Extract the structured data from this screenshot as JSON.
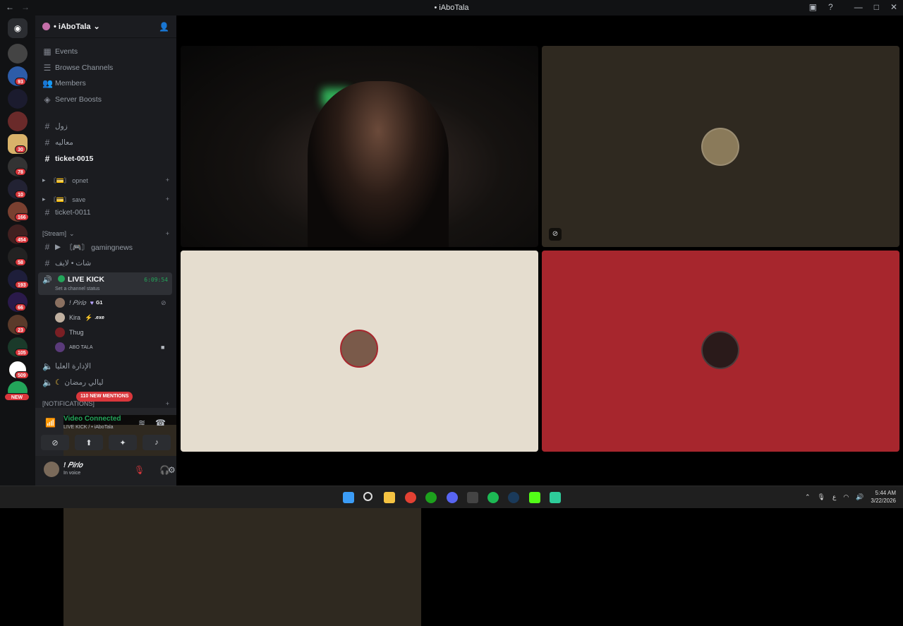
{
  "window": {
    "title": "• iAboTala"
  },
  "server": {
    "name": "• iAboTala"
  },
  "nav": [
    {
      "label": "Events",
      "icon": "calendar-icon"
    },
    {
      "label": "Browse Channels",
      "icon": "browse-icon"
    },
    {
      "label": "Members",
      "icon": "members-icon"
    },
    {
      "label": "Server Boosts",
      "icon": "boost-icon"
    }
  ],
  "channels": {
    "c1": "زول",
    "c2": "معاليه",
    "c3": "ticket-0015",
    "cat1": "〘💳〙 opnet",
    "cat2": "〘💳〙 save",
    "c4": "ticket-0011",
    "cat3": "[Stream]",
    "c5": "〘🎮〙 gamingnews",
    "c6": "شات • لايف",
    "live_name": "LIVE KICK",
    "live_timer": "6:09:54",
    "live_status": "Set a channel status",
    "c7": "الإدارة العليا",
    "c8": "ليالي رمضان",
    "cat4": "[NOTIFICATIONS]"
  },
  "voice_users": [
    {
      "name": "! 𝑃𝑖𝑟𝑙𝑜",
      "tag": "G1"
    },
    {
      "name": "Kira",
      "tag": ".exe"
    },
    {
      "name": "Thug",
      "tag": ""
    },
    {
      "name": "ABO TALA",
      "tag": ""
    }
  ],
  "mentions_pill": "110 NEW MENTIONS",
  "voice_panel": {
    "status": "Video Connected",
    "location": "LIVE KICK / • iAboTala"
  },
  "current_user": {
    "name": "! 𝑃𝑖𝑟𝑙𝑜",
    "status": "In voice"
  },
  "guild_badges": [
    "93",
    "30",
    "78",
    "10",
    "166",
    "454",
    "58",
    "193",
    "66",
    "23",
    "105",
    "509",
    "NEW"
  ],
  "clock": {
    "time": "5:44 AM",
    "date": "3/22/2026"
  },
  "colors": {
    "accent_green": "#23a55a",
    "badge_red": "#da373c",
    "tile_red": "#a7262d",
    "tile_beige": "#e5ddcf"
  }
}
